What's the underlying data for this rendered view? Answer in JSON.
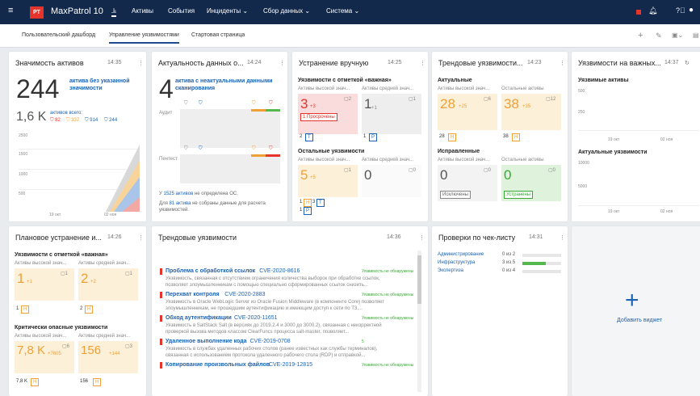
{
  "topbar": {
    "logo": "PT",
    "app_name": "MaxPatrol 10",
    "menu": [
      "Активы",
      "События",
      "Инциденты ⌄",
      "Сбор данных ⌄",
      "Система ⌄"
    ]
  },
  "subnav": {
    "tabs": [
      "Пользовательский дашборд",
      "Управление уязвимостями",
      "Стартовая страница"
    ]
  },
  "w1": {
    "title": "Значимость активов",
    "time": "14:35",
    "big": "244",
    "big_label1": "актива без указанной",
    "big_label2": "значимости",
    "total": "1,6 K",
    "total_label": "активов всего:",
    "c1": "82",
    "c2": "337",
    "c3": "914",
    "c4": "244",
    "y1": "2500",
    "y2": "1500",
    "y3": "1000",
    "y4": "500",
    "x1": "19 окт",
    "x2": "02 ноя"
  },
  "w2": {
    "title": "Актуальность данных о...",
    "time": "14:24",
    "big": "4",
    "label1": "актива с неактуальными данными",
    "label2": "сканирования",
    "audit": "Аудит",
    "pentest": "Пентест",
    "note1a": "У ",
    "note1b": "1525 активов",
    "note1c": " не определена ОС.",
    "note2a": "Для ",
    "note2b": "81 актива",
    "note2c": " не собраны данные для расчета",
    "note2d": "уязвимостей."
  },
  "w3": {
    "title": "Устранение вручную",
    "time": "14:25",
    "sec1": "Уязвимости с отметкой «важная»",
    "col1": "Активы высокой знач...",
    "col2": "Активы средней знач...",
    "v1": "3",
    "v1d": "+3",
    "v1c": "2",
    "v2": "1",
    "v2d": "+1",
    "v2c": "1",
    "overdue_n": "1",
    "overdue": "Просрочены",
    "b1n": "2",
    "b1": "T",
    "b2n": "1",
    "b2": "P",
    "sec2": "Остальные уязвимости",
    "v3": "5",
    "v3d": "+5",
    "v3c": "1",
    "v4": "0",
    "v4c": "0",
    "b3n": "1",
    "b3": "H",
    "b4n": "3",
    "b4": "T",
    "b5n": "1",
    "b5": "P"
  },
  "w4": {
    "title": "Трендовые уязвимости...",
    "time": "14:23",
    "sec1": "Актуальные",
    "col1": "Активы высокой знач...",
    "col2": "Остальные активы",
    "v1": "28",
    "v1d": "+25",
    "v1c": "6",
    "v2": "38",
    "v2d": "+35",
    "v2c": "12",
    "b1n": "28",
    "b1": "H",
    "b2n": "38",
    "b2": "H",
    "sec2": "Исправленные",
    "v3": "0",
    "v3c": "0",
    "v4": "0",
    "v4c": "0",
    "ex": "Исключены",
    "fx": "Устранены"
  },
  "w5": {
    "title": "Уязвимости на важных...",
    "time": "14:37",
    "sec1": "Уязвимые активы",
    "y1": "500",
    "y2": "250",
    "x1": "19 окт",
    "x2": "02 ноя",
    "sec2": "Актуальные уязвимости",
    "y3": "10000",
    "y4": "5000",
    "x3": "19 окт",
    "x4": "02 ноя"
  },
  "w6": {
    "title": "Плановое устранение и...",
    "time": "14:26",
    "sec1": "Уязвимости с отметкой «важная»",
    "col1": "Активы высокой знач...",
    "col2": "Активы средней знач...",
    "v1": "1",
    "v1d": "+1",
    "v1c": "1",
    "v2": "2",
    "v2d": "+2",
    "v2c": "1",
    "b1n": "1",
    "b1": "H",
    "b2n": "2",
    "b2": "H",
    "sec2": "Критически опасные уязвимости",
    "v3": "7,8 K",
    "v3d": "+7605",
    "v3c": "6",
    "v4": "156",
    "v4d": "+144",
    "v4c": "3",
    "b3n": "7,8 K",
    "b3": "H",
    "b4n": "156",
    "b4": "H"
  },
  "w7": {
    "title": "Трендовые уязвимости",
    "time": "14:36",
    "items": [
      {
        "name": "Проблема с обработкой ссылок",
        "cve": "CVE-2020-8616",
        "status": "Уязвимость не обнаружены",
        "d1": "Уязвимость, связанная с отсутствием ограничения количества выборок при обработке ссылок,",
        "d2": "позволяет злоумышленникам с помощью специально сформированных ссылок снизить..."
      },
      {
        "name": "Перехват контроля",
        "cve": "CVE-2020-2883",
        "status": "Уязвимость не обнаружены",
        "d1": "Уязвимость в Oracle WebLogic Server из Oracle Fusion Middleware (в компоненте Core) позволяет",
        "d2": "злоумышленникам, не прошедшим аутентификацию и имеющим доступ к сети по T3,..."
      },
      {
        "name": "Обход аутентификации",
        "cve": "CVE-2020-11651",
        "status": "Уязвимость не обнаружены",
        "d1": "Уязвимость в SaltStack Salt (в версиях до 2019.2.4 и 3000 до 3000.2), связанная с некорректной",
        "d2": "проверкой вызова методов классом ClearFuncs процесса salt-master, позволяет..."
      },
      {
        "name": "Удаленное выполнение кода",
        "cve": "CVE-2019-0708",
        "status": "5",
        "d1": "Уязвимость в службах удаленных рабочих столов (ранее известных как службы терминалов),",
        "d2": "связанная с использованием протокола удаленного рабочего стола (RDP) и отправкой..."
      },
      {
        "name": "Копирование произвольных файлов",
        "cve": "CVE-2019-12815",
        "status": "Уязвимость не обнаружены",
        "d1": "",
        "d2": ""
      }
    ]
  },
  "w8": {
    "title": "Проверки по чек-листу",
    "time": "14:31",
    "rows": [
      {
        "name": "Администрирование",
        "val": "0 из 2",
        "pct": 0
      },
      {
        "name": "Инфраструктура",
        "val": "3 из 5",
        "pct": 0.6
      },
      {
        "name": "Экспертиза",
        "val": "0 из 4",
        "pct": 0
      }
    ]
  },
  "w9": {
    "plus": "+",
    "label": "Добавить виджет"
  },
  "colors": {
    "accent": "#1a63b5",
    "orange": "#f0a034",
    "red": "#e4342b",
    "topbar": "#13294b"
  }
}
